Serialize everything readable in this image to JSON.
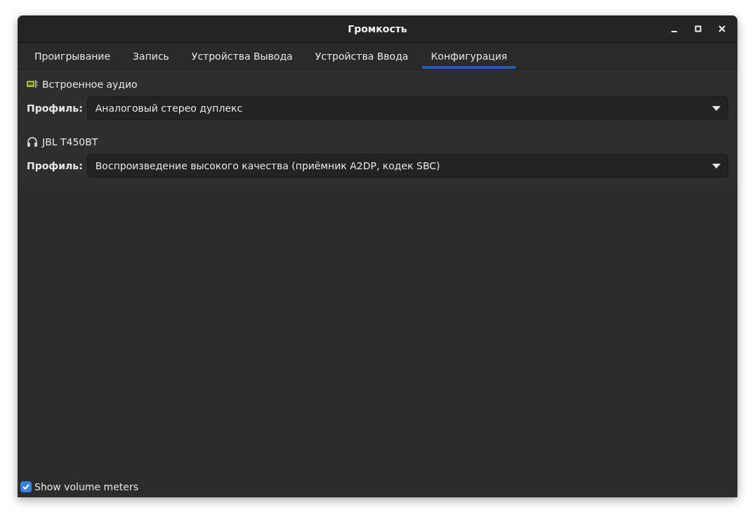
{
  "window": {
    "title": "Громкость"
  },
  "tabs": [
    {
      "label": "Проигрывание",
      "selected": false
    },
    {
      "label": "Запись",
      "selected": false
    },
    {
      "label": "Устройства Вывода",
      "selected": false
    },
    {
      "label": "Устройства Ввода",
      "selected": false
    },
    {
      "label": "Конфигурация",
      "selected": true
    }
  ],
  "devices": [
    {
      "kind": "sound-card",
      "name": "Встроенное аудио",
      "profile_label": "Профиль:",
      "profile": "Аналоговый стерео дуплекс"
    },
    {
      "kind": "headphones",
      "name": "JBL T450BT",
      "profile_label": "Профиль:",
      "profile": "Воспроизведение высокого качества (приёмник A2DP, кодек SBC)"
    }
  ],
  "show_volume_meters": {
    "label": "Show volume meters",
    "checked": true
  }
}
